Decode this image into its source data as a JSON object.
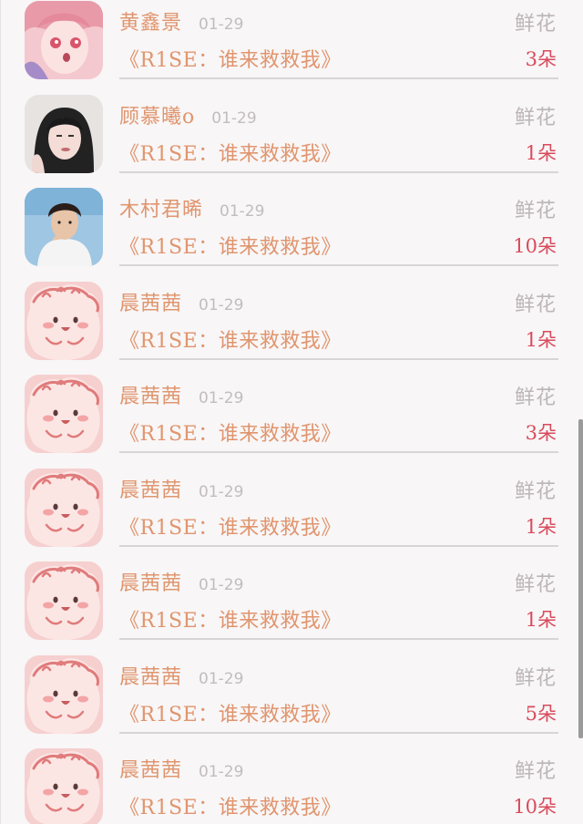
{
  "gift_records": [
    {
      "name": "黄鑫景",
      "date": "01-29",
      "gift": "鲜花",
      "work": "《R1SE：谁来救救我》",
      "count": "3朵",
      "avatar": "anime-girl-avatar"
    },
    {
      "name": "顾慕曦o",
      "date": "01-29",
      "gift": "鲜花",
      "work": "《R1SE：谁来救救我》",
      "count": "1朵",
      "avatar": "woman-portrait-avatar"
    },
    {
      "name": "木村君晞",
      "date": "01-29",
      "gift": "鲜花",
      "work": "《R1SE：谁来救救我》",
      "count": "10朵",
      "avatar": "man-portrait-avatar"
    },
    {
      "name": "晨茜茜",
      "date": "01-29",
      "gift": "鲜花",
      "work": "《R1SE：谁来救救我》",
      "count": "1朵",
      "avatar": "pink-blob-avatar"
    },
    {
      "name": "晨茜茜",
      "date": "01-29",
      "gift": "鲜花",
      "work": "《R1SE：谁来救救我》",
      "count": "3朵",
      "avatar": "pink-blob-avatar"
    },
    {
      "name": "晨茜茜",
      "date": "01-29",
      "gift": "鲜花",
      "work": "《R1SE：谁来救救我》",
      "count": "1朵",
      "avatar": "pink-blob-avatar"
    },
    {
      "name": "晨茜茜",
      "date": "01-29",
      "gift": "鲜花",
      "work": "《R1SE：谁来救救我》",
      "count": "1朵",
      "avatar": "pink-blob-avatar"
    },
    {
      "name": "晨茜茜",
      "date": "01-29",
      "gift": "鲜花",
      "work": "《R1SE：谁来救救我》",
      "count": "5朵",
      "avatar": "pink-blob-avatar"
    },
    {
      "name": "晨茜茜",
      "date": "01-29",
      "gift": "鲜花",
      "work": "《R1SE：谁来救救我》",
      "count": "10朵",
      "avatar": "pink-blob-avatar"
    }
  ],
  "colors": {
    "name": "#e0956e",
    "work": "#e0956e",
    "count": "#d94b5c",
    "muted": "#bdb5b8",
    "background": "#f8f6f7"
  }
}
